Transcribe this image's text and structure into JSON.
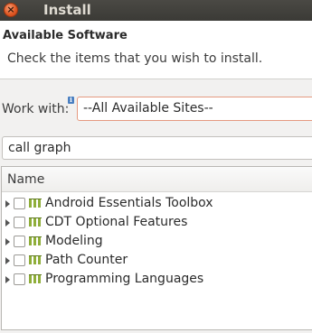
{
  "window": {
    "title": "Install",
    "close_glyph": "×"
  },
  "banner": {
    "title": "Available Software",
    "description": "Check the items that you wish to install."
  },
  "work_with": {
    "label": "Work with:",
    "info_glyph": "i",
    "value": "--All Available Sites--"
  },
  "filter": {
    "value": "call graph"
  },
  "tree": {
    "column_header": "Name",
    "items": [
      {
        "label": "Android Essentials Toolbox"
      },
      {
        "label": "CDT Optional Features"
      },
      {
        "label": "Modeling"
      },
      {
        "label": "Path Counter"
      },
      {
        "label": "Programming Languages"
      }
    ]
  },
  "colors": {
    "titlebar": "#3b3a36",
    "close_button": "#e05a25",
    "combo_border": "#e59a80",
    "category_icon": "#8fae3a"
  }
}
